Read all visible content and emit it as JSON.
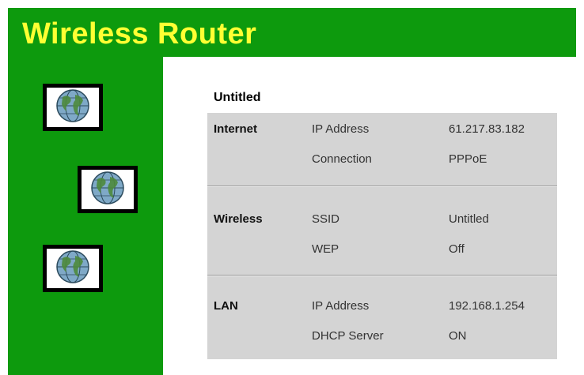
{
  "header": {
    "title": "Wireless Router"
  },
  "sidebar": {
    "icons": [
      {
        "name": "globe-icon"
      },
      {
        "name": "globe-icon"
      },
      {
        "name": "globe-icon"
      }
    ]
  },
  "main": {
    "router_name": "Untitled",
    "sections": [
      {
        "label": "Internet",
        "rows": [
          {
            "label": "IP Address",
            "value": "61.217.83.182"
          },
          {
            "label": "Connection",
            "value": "PPPoE"
          }
        ]
      },
      {
        "label": "Wireless",
        "rows": [
          {
            "label": "SSID",
            "value": "Untitled"
          },
          {
            "label": "WEP",
            "value": "Off"
          }
        ]
      },
      {
        "label": "LAN",
        "rows": [
          {
            "label": "IP Address",
            "value": "192.168.1.254"
          },
          {
            "label": "DHCP Server",
            "value": "ON"
          }
        ]
      }
    ]
  },
  "colors": {
    "frame_green": "#0d9a0d",
    "title_yellow": "#ffff33",
    "panel_gray": "#d4d4d4"
  }
}
